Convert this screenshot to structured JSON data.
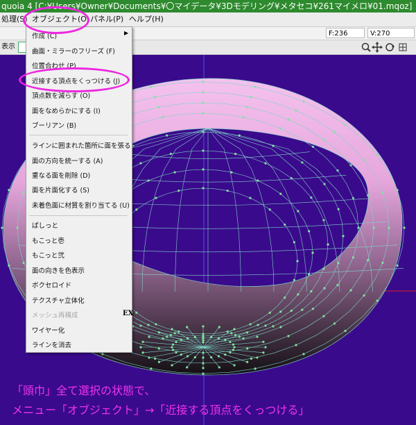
{
  "window": {
    "title": "quoia 4 [C:¥Users¥Owner¥Documents¥〇マイデータ¥3Dモデリング¥メタセコ¥261マイメロ¥01.mqoz]"
  },
  "menubar": {
    "items": [
      {
        "label": "処理(S)"
      },
      {
        "label": "オブジェクト(O)"
      },
      {
        "label": "パネル(P)"
      },
      {
        "label": "ヘルプ(H)"
      }
    ]
  },
  "toolbar": {
    "face_count": "F:236",
    "vertex_count": "V:270",
    "mode_label": "表示"
  },
  "object_menu": {
    "items": [
      {
        "label": "作成 (C)",
        "has_submenu": true,
        "disabled": false
      },
      {
        "label": "曲面・ミラーのフリーズ (F)",
        "disabled": false
      },
      {
        "label": "位置合わせ (P)",
        "disabled": false
      },
      {
        "label": "近接する頂点をくっつける (J)",
        "disabled": false
      },
      {
        "label": "頂点数を減らす (O)",
        "disabled": false
      },
      {
        "label": "面をなめらかにする (I)",
        "disabled": false
      },
      {
        "label": "ブーリアン (B)",
        "disabled": false
      },
      {
        "label": "ラインに囲まれた箇所に面を張る",
        "disabled": false
      },
      {
        "label": "面の方向を統一する (A)",
        "disabled": false
      },
      {
        "label": "重なる面を削除 (D)",
        "disabled": false
      },
      {
        "label": "面を片面化する (S)",
        "disabled": false
      },
      {
        "label": "未着色面に材質を割り当てる (U)",
        "disabled": false
      },
      {
        "label": "ぱしっと",
        "disabled": false
      },
      {
        "label": "もこっと壱",
        "disabled": false
      },
      {
        "label": "もこっと弐",
        "disabled": false
      },
      {
        "label": "面の向きを色表示",
        "disabled": false
      },
      {
        "label": "ボクセロイド",
        "disabled": false
      },
      {
        "label": "テクスチャ立体化",
        "disabled": false
      },
      {
        "label": "メッシュ再構成",
        "disabled": true
      },
      {
        "label": "ワイヤー化",
        "disabled": false
      },
      {
        "label": "ラインを消去",
        "disabled": false
      }
    ],
    "ex_badge": "EX"
  },
  "annotation": {
    "line1": "「頭巾」全て選択の状態で、",
    "line2": "メニュー「オブジェクト」→「近接する頂点をくっつける」",
    "color": "#ee33ee"
  },
  "colors": {
    "viewport_bg": "#3a0a8c",
    "titlebar_bg": "#2e8a2e",
    "highlight_circle": "#ee26e0",
    "wire": "#7fd4c8",
    "vertex": "#7fe4a0",
    "torus_light": "#f7c8f0"
  }
}
